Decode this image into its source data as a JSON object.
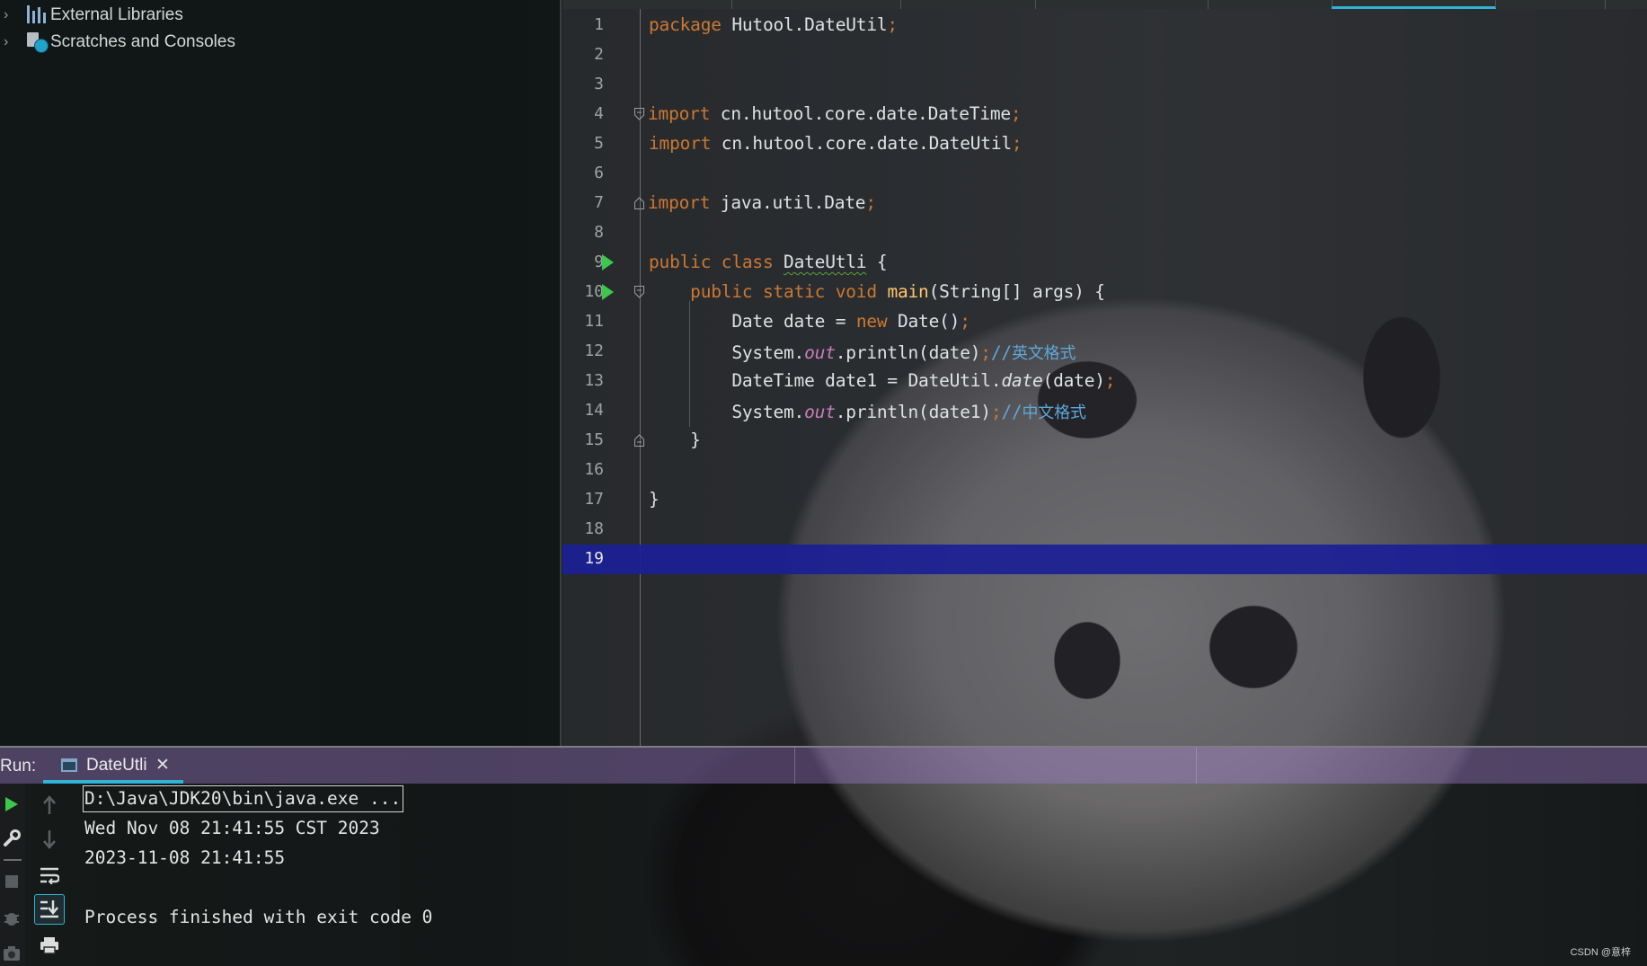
{
  "project_tree": {
    "items": [
      {
        "label": "External Libraries"
      },
      {
        "label": "Scratches and Consoles"
      }
    ]
  },
  "editor": {
    "line_numbers": [
      "1",
      "2",
      "3",
      "4",
      "5",
      "6",
      "7",
      "8",
      "9",
      "10",
      "11",
      "12",
      "13",
      "14",
      "15",
      "16",
      "17",
      "18",
      "19"
    ],
    "current_line": "19",
    "code": {
      "l1_kw": "package",
      "l1_rest": " Hutool.DateUtil",
      "l1_semi": ";",
      "l4_kw": "import",
      "l4_rest": " cn.hutool.core.date.DateTime",
      "l4_semi": ";",
      "l5_kw": "import",
      "l5_rest": " cn.hutool.core.date.DateUtil",
      "l5_semi": ";",
      "l7_kw": "import",
      "l7_rest": " java.util.Date",
      "l7_semi": ";",
      "l9_kw": "public class ",
      "l9_class": "DateUtli",
      "l9_rest": " {",
      "l10_indent": "    ",
      "l10_kw": "public static void ",
      "l10_meth": "main",
      "l10_rest": "(String[] args) {",
      "l11_a": "        Date date = ",
      "l11_kw": "new",
      "l11_b": " Date()",
      "l11_semi": ";",
      "l12_a": "        System.",
      "l12_field": "out",
      "l12_b": ".println(date)",
      "l12_semi": ";",
      "l12_cmt_slash": "//",
      "l12_cmt": "英文格式",
      "l13_a": "        DateTime date1 = DateUtil.",
      "l13_ital": "date",
      "l13_b": "(date)",
      "l13_semi": ";",
      "l14_a": "        System.",
      "l14_field": "out",
      "l14_b": ".println(date1)",
      "l14_semi": ";",
      "l14_cmt_slash": "//",
      "l14_cmt": "中文格式",
      "l15": "    }",
      "l17": "}"
    }
  },
  "run_window": {
    "label": "Run:",
    "tab_label": "DateUtli",
    "tab_close": "✕",
    "console": {
      "line1": "D:\\Java\\JDK20\\bin\\java.exe ...",
      "line2": "Wed Nov 08 21:41:55 CST 2023",
      "line3": "2023-11-08 21:41:55",
      "line5": "Process finished with exit code 0"
    }
  },
  "watermark": "CSDN @意梓",
  "colors": {
    "keyword": "#cc7832",
    "method": "#ffc66d",
    "static_field": "#c77dbb",
    "comment": "#5ea7d8",
    "current_line": "#1a1f96",
    "accent": "#2fb4d8",
    "run_green": "#3cc94b"
  }
}
